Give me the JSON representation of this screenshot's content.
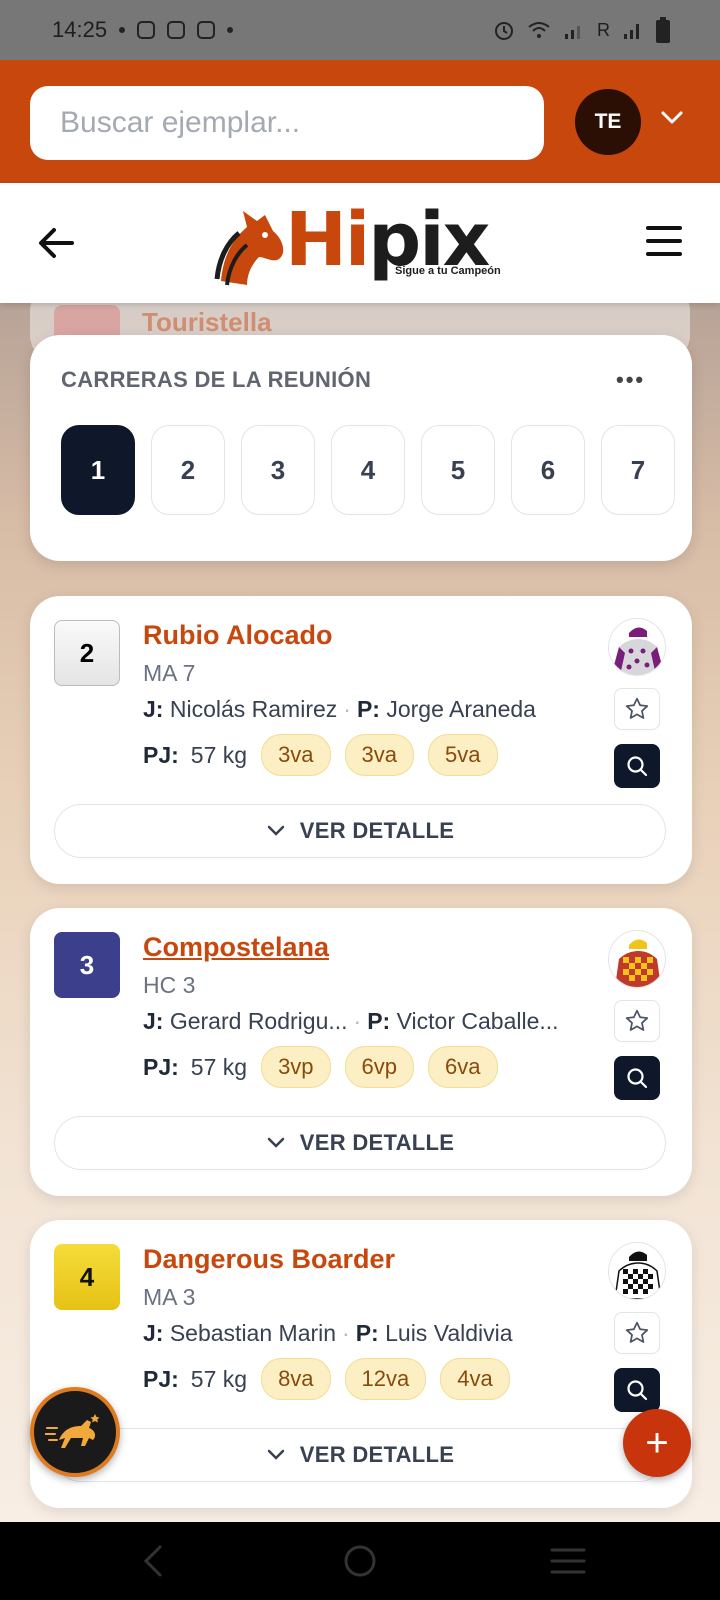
{
  "status_bar": {
    "time": "14:25",
    "carrier": "R"
  },
  "header": {
    "search_placeholder": "Buscar ejemplar...",
    "avatar_initials": "TE"
  },
  "logo": {
    "text_a": "Hi",
    "text_b": "pix",
    "tagline": "Sigue a tu Campeón"
  },
  "peek_card": {
    "name": "Touristella"
  },
  "races": {
    "title": "CARRERAS DE LA REUNIÓN",
    "more": "•••",
    "items": [
      "1",
      "2",
      "3",
      "4",
      "5",
      "6",
      "7"
    ],
    "active": "1"
  },
  "labels": {
    "jockey": "J:",
    "trainer": "P:",
    "weight": "PJ:",
    "detail": "VER DETALLE"
  },
  "horses": [
    {
      "number": "2",
      "name": "Rubio Alocado",
      "class": "MA 7",
      "jockey": "Nicolás Ramirez",
      "trainer": "Jorge Araneda",
      "weight": "57 kg",
      "results": [
        "3va",
        "3va",
        "5va"
      ],
      "badge_color": "#f3f3f3",
      "badge_text_color": "#111111"
    },
    {
      "number": "3",
      "name": "Compostelana",
      "class": "HC 3",
      "jockey": "Gerard Rodrigu...",
      "trainer": "Victor Caballe...",
      "weight": "57 kg",
      "results": [
        "3vp",
        "6vp",
        "6va"
      ],
      "badge_color": "#3b3f8c",
      "badge_text_color": "#ffffff"
    },
    {
      "number": "4",
      "name": "Dangerous Boarder",
      "class": "MA 3",
      "jockey": "Sebastian Marin",
      "trainer": "Luis Valdivia",
      "weight": "57 kg",
      "results": [
        "8va",
        "12va",
        "4va"
      ],
      "badge_color": "#f1d21f",
      "badge_text_color": "#111111"
    }
  ],
  "fab": {
    "plus": "+"
  },
  "colors": {
    "brand": "#c8470c",
    "dark": "#0f172a",
    "pill_bg": "#fcefc4"
  }
}
